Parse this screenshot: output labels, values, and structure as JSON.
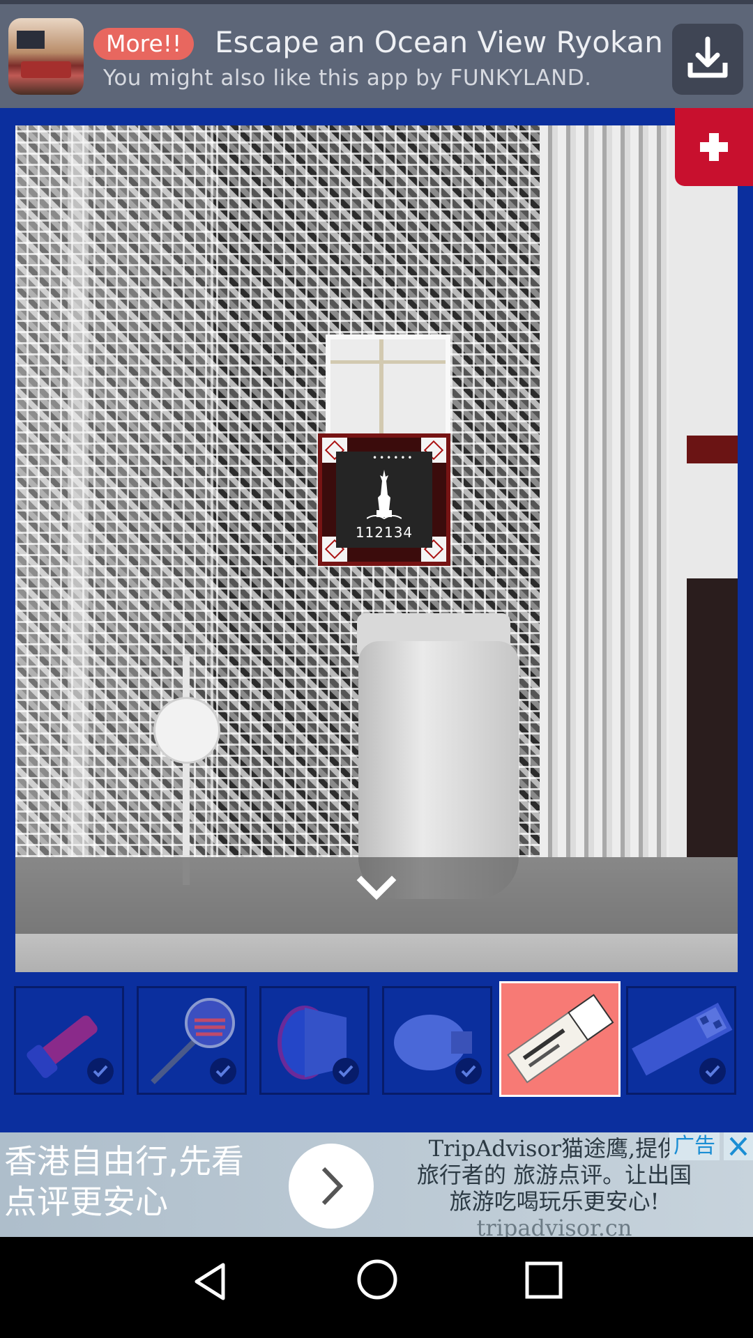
{
  "promo": {
    "more_label": "More!!",
    "title": "Escape an Ocean View Ryokan",
    "subtitle": "You might also like this app by FUNKYLAND.",
    "download_icon": "download-icon"
  },
  "scene": {
    "poster_code": "112134",
    "poster_dots": "••••••"
  },
  "inventory": {
    "items": [
      {
        "name": "flashlight",
        "checked": true
      },
      {
        "name": "flag-fan",
        "checked": true
      },
      {
        "name": "cup",
        "checked": true
      },
      {
        "name": "knob",
        "checked": true
      },
      {
        "name": "museum-ticket",
        "checked": false,
        "selected": true
      },
      {
        "name": "qr-card",
        "checked": true
      }
    ]
  },
  "ad": {
    "left_text_line1": "香港自由行,先看",
    "left_text_line2": "点评更安心",
    "right_line1": "TripAdvisor猫途鹰,提供",
    "right_line2": "旅行者的 旅游点评。让出国",
    "right_line3": "旅游吃喝玩乐更安心!",
    "domain": "tripadvisor.cn",
    "badge": "广告"
  },
  "colors": {
    "frame_blue": "#0b2f9e",
    "plus_red": "#c8102e",
    "selected_slot": "#f77a75",
    "more_pill": "#e8675f"
  }
}
